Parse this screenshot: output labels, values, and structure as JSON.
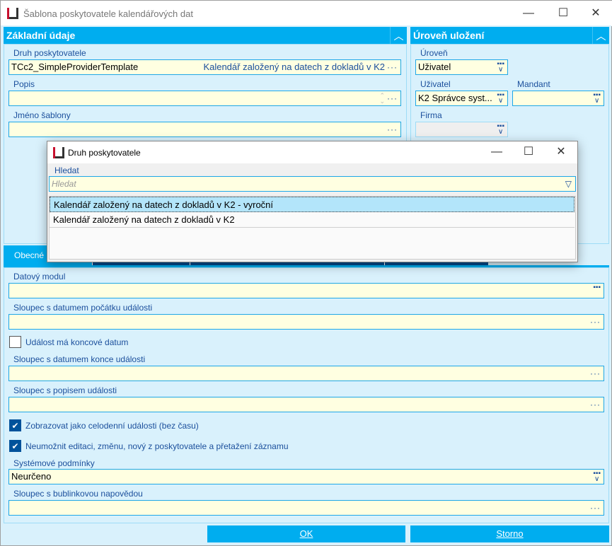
{
  "window": {
    "title": "Šablona poskytovatele kalendářových dat",
    "minimize": "—",
    "maximize": "☐",
    "close": "✕",
    "logo": "K2"
  },
  "basic": {
    "header": "Základní údaje",
    "collapse": "︿",
    "provider_type": {
      "label": "Druh poskytovatele",
      "value": "TCc2_SimpleProviderTemplate",
      "description": "Kalendář založený na datech z dokladů v K2"
    },
    "description": {
      "label": "Popis",
      "value": ""
    },
    "template_name": {
      "label": "Jméno šablony",
      "value": ""
    }
  },
  "storage": {
    "header": "Úroveň uložení",
    "collapse": "︿",
    "level": {
      "label": "Úroveň",
      "value": "Uživatel"
    },
    "user": {
      "label": "Uživatel",
      "value": "K2 Správce syst..."
    },
    "mandant": {
      "label": "Mandant",
      "value": ""
    },
    "company": {
      "label": "Firma",
      "value": ""
    }
  },
  "tabs": [
    {
      "label": "Obecné",
      "active": true
    },
    {
      "label": ""
    },
    {
      "label": ""
    },
    {
      "label": ""
    }
  ],
  "general": {
    "data_module": {
      "label": "Datový modul",
      "value": ""
    },
    "start_date_col": {
      "label": "Sloupec s datumem počátku události",
      "value": ""
    },
    "has_end_date": {
      "label": "Událost má koncové datum",
      "checked": false
    },
    "end_date_col": {
      "label": "Sloupec s datumem konce události",
      "value": ""
    },
    "desc_col": {
      "label": "Sloupec s popisem události",
      "value": ""
    },
    "all_day": {
      "label": "Zobrazovat jako celodenní události (bez času)",
      "checked": true
    },
    "no_edit": {
      "label": "Neumožnit editaci, změnu, nový z poskytovatele a přetažení záznamu",
      "checked": true
    },
    "sys_conditions": {
      "label": "Systémové podmínky",
      "value": "Neurčeno"
    },
    "tooltip_col": {
      "label": "Sloupec s bublinkovou napovědou",
      "value": ""
    }
  },
  "buttons": {
    "ok": "OK",
    "cancel": "Storno"
  },
  "popup": {
    "title": "Druh poskytovatele",
    "search_label": "Hledat",
    "search_placeholder": "Hledat",
    "items": [
      {
        "label": "Kalendář založený na datech z dokladů v K2 - vyroční",
        "selected": true
      },
      {
        "label": "Kalendář založený na datech z dokladů v K2",
        "selected": false
      }
    ]
  },
  "colors": {
    "accent": "#00adef",
    "panel": "#d9f1fc",
    "input": "#ffffe1",
    "tab_dark": "#004a8c",
    "selected": "#b3e5fa"
  }
}
